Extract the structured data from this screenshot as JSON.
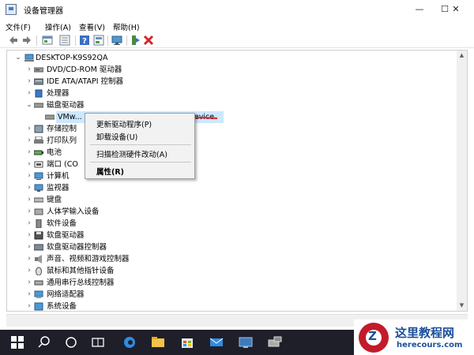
{
  "window": {
    "title": "设备管理器",
    "controls": [
      "—",
      "☐",
      "✕"
    ]
  },
  "menubar": [
    "文件(F)",
    "操作(A)",
    "查看(V)",
    "帮助(H)"
  ],
  "toolbar": [
    "back-arrow-icon",
    "forward-arrow-icon",
    "properties-icon",
    "list-icon",
    "help-icon",
    "console-icon",
    "monitor-icon",
    "update-driver-icon",
    "uninstall-icon"
  ],
  "tree": {
    "root": "DESKTOP-K9S92QA",
    "items": [
      {
        "label": "DVD/CD-ROM 驱动器",
        "icon": "dvd-icon",
        "expanded": false
      },
      {
        "label": "IDE ATA/ATAPI 控制器",
        "icon": "ide-icon",
        "expanded": false
      },
      {
        "label": "处理器",
        "icon": "processor-icon",
        "expanded": false
      },
      {
        "label": "磁盘驱动器",
        "icon": "disk-icon",
        "expanded": true
      },
      {
        "label": "VMw... VMware Virtual S SCSI Disk Device",
        "icon": "disk-icon",
        "child": true,
        "selected": true
      },
      {
        "label": "存储控制",
        "icon": "storage-icon",
        "expanded": false
      },
      {
        "label": "打印队列",
        "icon": "printer-icon",
        "expanded": false
      },
      {
        "label": "电池",
        "icon": "battery-icon",
        "expanded": false
      },
      {
        "label": "端口 (CO",
        "icon": "port-icon",
        "expanded": false
      },
      {
        "label": "计算机",
        "icon": "computer-icon",
        "expanded": false
      },
      {
        "label": "监视器",
        "icon": "monitor-icon",
        "expanded": false
      },
      {
        "label": "键盘",
        "icon": "keyboard-icon",
        "expanded": false
      },
      {
        "label": "人体学输入设备",
        "icon": "hid-icon",
        "expanded": false
      },
      {
        "label": "软件设备",
        "icon": "software-device-icon",
        "expanded": false
      },
      {
        "label": "软盘驱动器",
        "icon": "floppy-icon",
        "expanded": false
      },
      {
        "label": "软盘驱动器控制器",
        "icon": "floppy-controller-icon",
        "expanded": false
      },
      {
        "label": "声音、视频和游戏控制器",
        "icon": "sound-icon",
        "expanded": false
      },
      {
        "label": "鼠标和其他指针设备",
        "icon": "mouse-icon",
        "expanded": false
      },
      {
        "label": "通用串行总线控制器",
        "icon": "usb-icon",
        "expanded": false
      },
      {
        "label": "网络适配器",
        "icon": "network-icon",
        "expanded": false
      },
      {
        "label": "系统设备",
        "icon": "system-icon",
        "expanded": false
      }
    ]
  },
  "context_menu": {
    "update_driver": "更新驱动程序(P)",
    "uninstall": "卸载设备(U)",
    "scan": "扫描检测硬件改动(A)",
    "properties": "属性(R)"
  },
  "taskbar": [
    "windows-start-icon",
    "search-icon",
    "cortana-icon",
    "task-view-icon",
    "edge-icon",
    "file-explorer-icon",
    "store-icon",
    "mail-icon",
    "remote-icon",
    "device-manager-icon"
  ],
  "watermark": {
    "logo_letter": "Z",
    "title": "这里教程网",
    "url": "herecours.com"
  },
  "colors": {
    "selection": "#cce8ff",
    "taskbar": "#1f1f2a",
    "arrow": "#d9222a",
    "watermark_blue": "#1b4f9c",
    "watermark_red": "#c21b2b"
  }
}
